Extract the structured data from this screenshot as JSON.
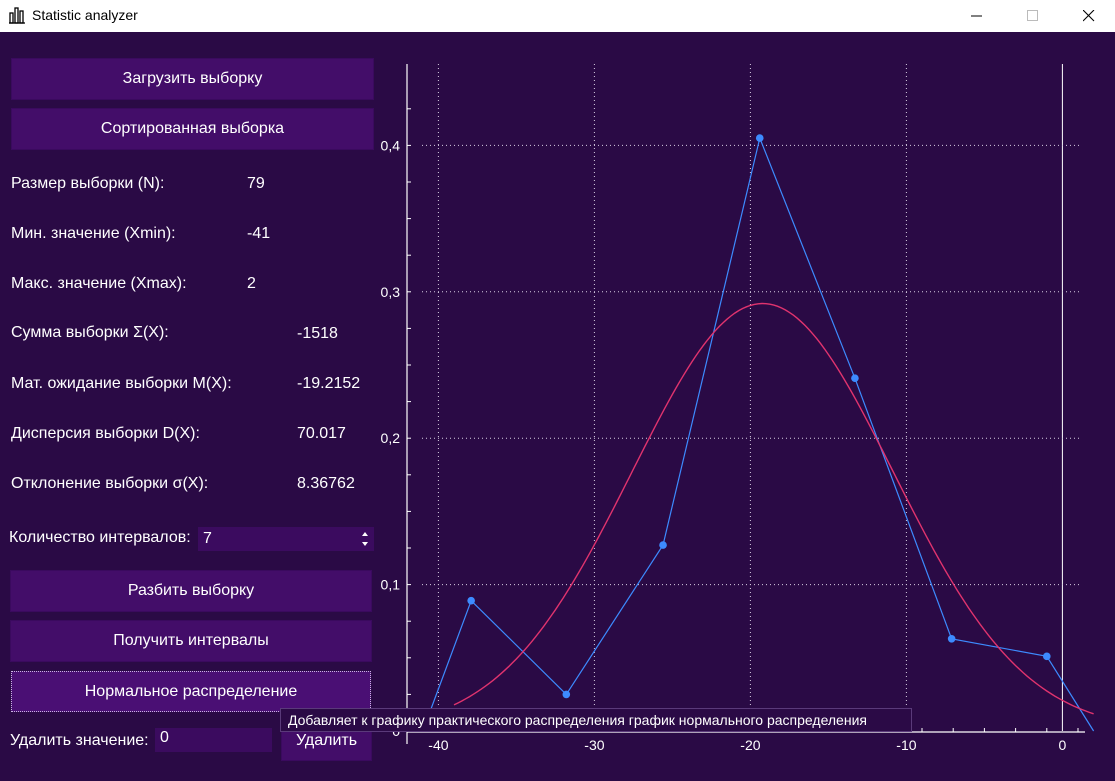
{
  "window": {
    "title": "Statistic analyzer",
    "icon": "bar-chart-icon",
    "controls": [
      "minimize-icon",
      "maximize-icon",
      "close-icon"
    ]
  },
  "buttons": {
    "load_sample": "Загрузить выборку",
    "sorted_sample": "Сортированная выборка",
    "split_sample": "Разбить выборку",
    "get_intervals": "Получить интервалы",
    "normal_distribution": "Нормальное распределение",
    "delete": "Удалить"
  },
  "stats": [
    {
      "label": "Размер выборки (N):",
      "value": "79"
    },
    {
      "label": "Мин. значение (Xmin):",
      "value": "-41"
    },
    {
      "label": "Макс. значение (Xmax):",
      "value": "2"
    },
    {
      "label": "Сумма выборки Σ(X):",
      "value": "-1518"
    },
    {
      "label": "Мат. ожидание выборки M(X):",
      "value": "-19.2152"
    },
    {
      "label": "Дисперсия выборки D(X):",
      "value": "70.017"
    },
    {
      "label": "Отклонение выборки σ(X):",
      "value": "8.36762"
    }
  ],
  "intervals": {
    "label": "Количество интервалов:",
    "value": "7"
  },
  "delete_value": {
    "label": "Удалить значение:",
    "value": "0"
  },
  "tooltip": "Добавляет к графику практического распределения график нормального распределения",
  "colors": {
    "background": "#2a0a45",
    "button": "#430d69",
    "practical_series": "#3d8bff",
    "normal_series": "#e0336e",
    "grid": "#d8cfe3"
  },
  "chart_data": {
    "type": "line",
    "xlim": [
      -41,
      2
    ],
    "ylim": [
      0,
      0.45
    ],
    "x_ticks": [
      -40,
      -30,
      -20,
      -10,
      0
    ],
    "x_tick_labels": [
      "-40",
      "-30",
      "-20",
      "-10",
      "0"
    ],
    "y_ticks": [
      0,
      0.1,
      0.2,
      0.3,
      0.4
    ],
    "y_tick_labels": [
      "0",
      "0,1",
      "0,2",
      "0,3",
      "0,4"
    ],
    "grid": true,
    "series": [
      {
        "x": [
          -41,
          -37.9,
          -31.8,
          -25.6,
          -19.4,
          -13.3,
          -7.1,
          -1,
          2
        ],
        "y": [
          0,
          0.089,
          0.025,
          0.127,
          0.405,
          0.241,
          0.063,
          0.051,
          0
        ],
        "color": "#3d8bff",
        "markers": true
      },
      {
        "type": "normal_curve",
        "mean": -19.2152,
        "sigma": 8.36762,
        "peak": 0.292,
        "x_from": -39,
        "x_to": 2,
        "color": "#e0336e"
      }
    ]
  }
}
